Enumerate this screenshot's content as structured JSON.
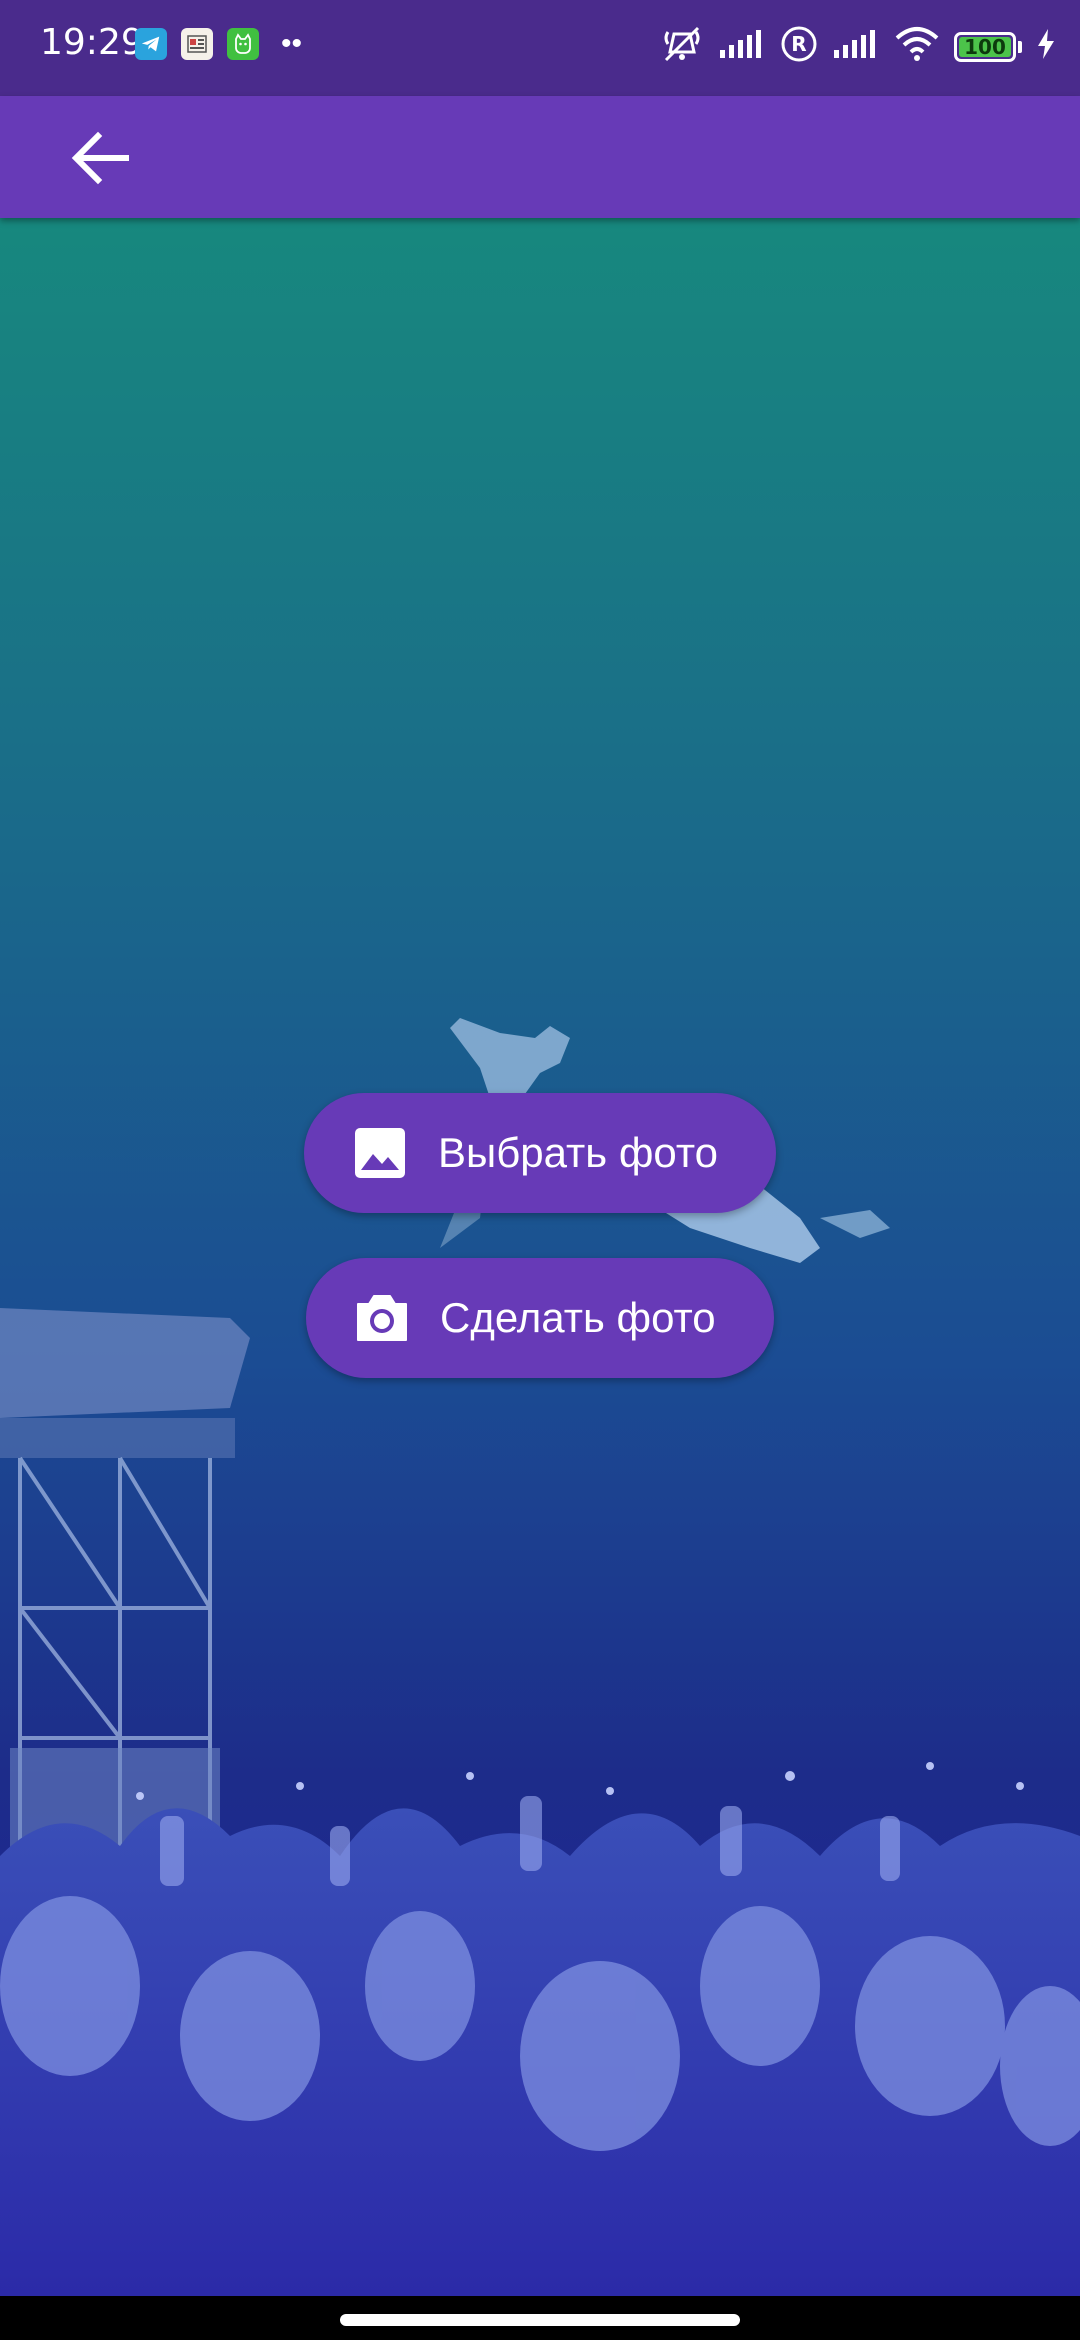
{
  "status_bar": {
    "time": "19:29",
    "notification_icons": [
      "telegram-icon",
      "news-app-icon",
      "cat-app-icon"
    ],
    "battery_level": "100",
    "indicators": [
      "mute-icon",
      "signal-icon",
      "roaming-icon",
      "signal-icon",
      "wifi-icon",
      "battery-icon",
      "charging-icon"
    ]
  },
  "app_bar": {
    "back_icon": "arrow-back-icon"
  },
  "actions": {
    "choose_photo": "Выбрать фото",
    "take_photo": "Сделать фото"
  },
  "background": {
    "description_icon": "concert-crowd-photo"
  },
  "colors": {
    "status_bar": "#4a2b8c",
    "app_bar": "#673ab7",
    "button": "#673ab7",
    "gradient_top": "#17887e",
    "gradient_bottom": "#2020a0",
    "battery_fill": "#4cc34a"
  }
}
